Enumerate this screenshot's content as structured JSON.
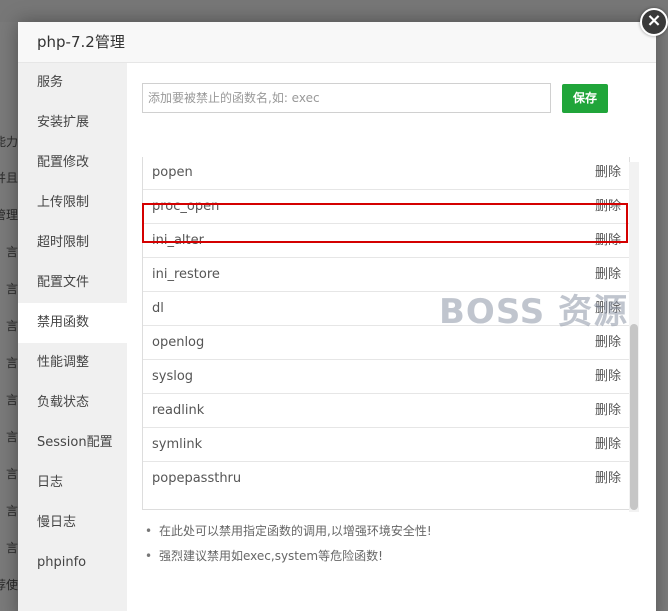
{
  "background": {
    "fragments": [
      "能力",
      "并且",
      "管理",
      "言",
      "言",
      "言",
      "言",
      "言",
      "言",
      "言",
      "言",
      "言",
      "荐使"
    ]
  },
  "modal": {
    "title": "php-7.2管理",
    "close_icon": "close-icon"
  },
  "sidebar": {
    "items": [
      {
        "label": "服务"
      },
      {
        "label": "安装扩展"
      },
      {
        "label": "配置修改"
      },
      {
        "label": "上传限制"
      },
      {
        "label": "超时限制"
      },
      {
        "label": "配置文件"
      },
      {
        "label": "禁用函数",
        "active": true
      },
      {
        "label": "性能调整"
      },
      {
        "label": "负载状态"
      },
      {
        "label": "Session配置"
      },
      {
        "label": "日志"
      },
      {
        "label": "慢日志"
      },
      {
        "label": "phpinfo"
      }
    ]
  },
  "main": {
    "input_placeholder": "添加要被禁止的函数名,如: exec",
    "save_label": "保存",
    "functions": [
      {
        "name": "popen",
        "action": "删除"
      },
      {
        "name": "proc_open",
        "action": "删除",
        "highlighted": true
      },
      {
        "name": "ini_alter",
        "action": "删除"
      },
      {
        "name": "ini_restore",
        "action": "删除"
      },
      {
        "name": "dl",
        "action": "删除"
      },
      {
        "name": "openlog",
        "action": "删除"
      },
      {
        "name": "syslog",
        "action": "删除"
      },
      {
        "name": "readlink",
        "action": "删除"
      },
      {
        "name": "symlink",
        "action": "删除"
      },
      {
        "name": "popepassthru",
        "action": "删除"
      }
    ],
    "tips": [
      "在此处可以禁用指定函数的调用,以增强环境安全性!",
      "强烈建议禁用如exec,system等危险函数!"
    ]
  },
  "watermark": "BOSS 资源",
  "colors": {
    "accent": "#20a53a",
    "highlight_border": "#d40000"
  }
}
